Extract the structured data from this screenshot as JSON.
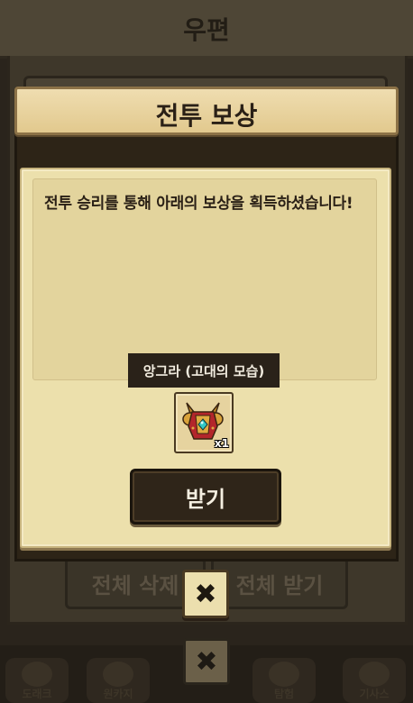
{
  "background_screen": {
    "title": "우편",
    "delete_all_label": "전체 삭제",
    "receive_all_label": "전체 받기",
    "close_symbol": "✖",
    "nav_items": [
      {
        "label": "도래크",
        "icon": "cat-icon"
      },
      {
        "label": "원카지",
        "icon": "meat-icon"
      },
      {
        "label": "",
        "icon": "blank"
      },
      {
        "label": "탐험",
        "icon": "compass-icon"
      },
      {
        "label": "기사스",
        "icon": "character-icon"
      }
    ]
  },
  "reward_modal": {
    "title": "전투 보상",
    "message": "전투 승리를 통해 아래의 보상을 획득하셨습니다!",
    "item": {
      "name": "앙그라 (고대의 모습)",
      "quantity": "x1",
      "icon": "armor-chest-icon"
    },
    "receive_label": "받기",
    "close_symbol": "✖"
  },
  "colors": {
    "parchment": "#ece0ac",
    "header_gold": "#e2c98e",
    "dark_button": "#2f2519",
    "dim_background": "#3e372a"
  }
}
